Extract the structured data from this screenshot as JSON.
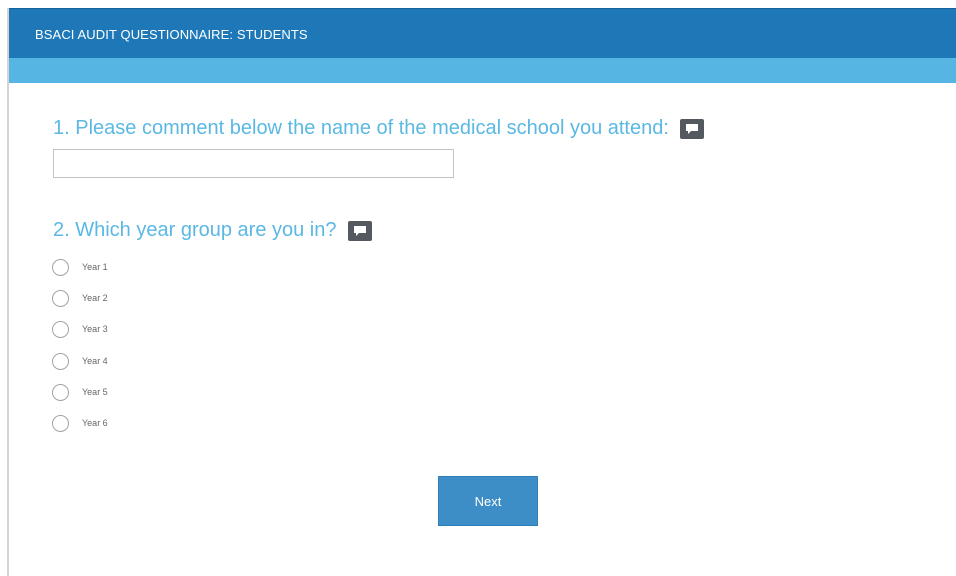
{
  "header": {
    "title": "BSACI AUDIT QUESTIONNAIRE: STUDENTS",
    "color": "#1e78b8",
    "subbar_color": "#56b5e3"
  },
  "questions": [
    {
      "title": "1. Please comment below the name of the medical school you attend:",
      "comment_icon": "comment-icon",
      "input_value": "",
      "input_placeholder": ""
    },
    {
      "title": "2. Which year group are you in?",
      "comment_icon": "comment-icon",
      "options": [
        "Year 1",
        "Year 2",
        "Year 3",
        "Year 4",
        "Year 5",
        "Year 6"
      ],
      "selected": null
    }
  ],
  "footer": {
    "next_label": "Next",
    "button_color": "#3d8dc7"
  },
  "colors": {
    "question_text": "#5ab8e3",
    "icon_bg": "#53595e"
  }
}
